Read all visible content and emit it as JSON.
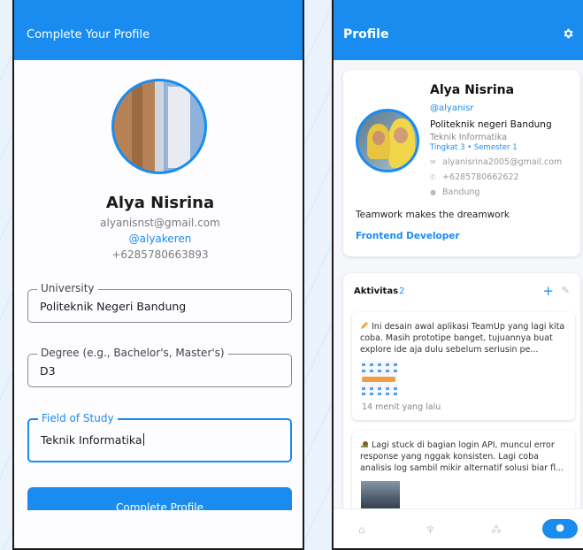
{
  "left": {
    "title": "Complete Your Profile",
    "name": "Alya Nisrina",
    "email": "alyanisnst@gmail.com",
    "handle": "@alyakeren",
    "phone": "+6285780663893",
    "fields": [
      {
        "label": "University",
        "value": "Politeknik Negeri Bandung"
      },
      {
        "label": "Degree (e.g., Bachelor's, Master's)",
        "value": "D3"
      },
      {
        "label": "Field of Study",
        "value": "Teknik Informatika"
      }
    ],
    "button": "Complete Profile"
  },
  "right": {
    "title": "Profile",
    "name": "Alya Nisrina",
    "handle": "@alyanisr",
    "school": "Politeknik negeri Bandung",
    "major": "Teknik Informatika",
    "level": "Tingkat 3 • Semester 1",
    "email": "alyanisrina2005@gmail.com",
    "phone": "+6285780662622",
    "city": "Bandung",
    "bio": "Teamwork makes the dreamwork",
    "role": "Frontend Developer",
    "activity_title": "Aktivitas",
    "activity_count": "2",
    "posts": [
      {
        "text": "Ini desain awal aplikasi TeamUp yang lagi kita coba. Masih prototipe banget, tujuannya buat explore ide aja dulu sebelum seriusin pe...",
        "time": "14 menit yang lalu"
      },
      {
        "text": "Lagi stuck di bagian login API, muncul error response yang nggak konsisten. Lagi coba analisis log sambil mikir alternatif solusi biar fl..."
      }
    ]
  },
  "colors": {
    "accent": "#1a8cf0"
  }
}
